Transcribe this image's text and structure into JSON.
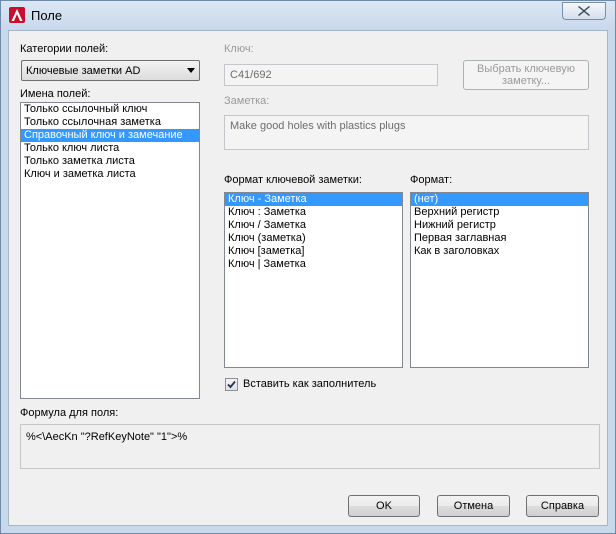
{
  "window": {
    "title": "Поле"
  },
  "field_categories": {
    "label": "Категории полей:",
    "selected": "Ключевые заметки AD"
  },
  "field_names": {
    "label": "Имена полей:",
    "items": [
      "Только ссылочный ключ",
      "Только ссылочная заметка",
      "Справочный ключ и замечание",
      "Только ключ листа",
      "Только заметка листа",
      "Ключ и заметка листа"
    ],
    "selected_index": 2
  },
  "key": {
    "label": "Ключ:",
    "value": "C41/692"
  },
  "select_key_button": {
    "line1": "Выбрать ключевую",
    "line2": "заметку..."
  },
  "note": {
    "label": "Заметка:",
    "value": "Make good holes with plastics plugs"
  },
  "keynote_format": {
    "label": "Формат ключевой заметки:",
    "items": [
      "Ключ  - Заметка",
      "Ключ  : Заметка",
      "Ключ  / Заметка",
      "Ключ (заметка)",
      "Ключ [заметка]",
      "Ключ | Заметка"
    ],
    "selected_index": 0
  },
  "format": {
    "label": "Формат:",
    "items": [
      "(нет)",
      "Верхний регистр",
      "Нижний регистр",
      "Первая заглавная",
      "Как в заголовках"
    ],
    "selected_index": 0
  },
  "insert_placeholder": {
    "label": "Вставить как заполнитель",
    "checked": true
  },
  "field_formula": {
    "label": "Формула для поля:",
    "value": "%<\\AecKn \"?RefKeyNote\" \"1\">%"
  },
  "buttons": {
    "ok": "OK",
    "cancel": "Отмена",
    "help": "Справка"
  }
}
